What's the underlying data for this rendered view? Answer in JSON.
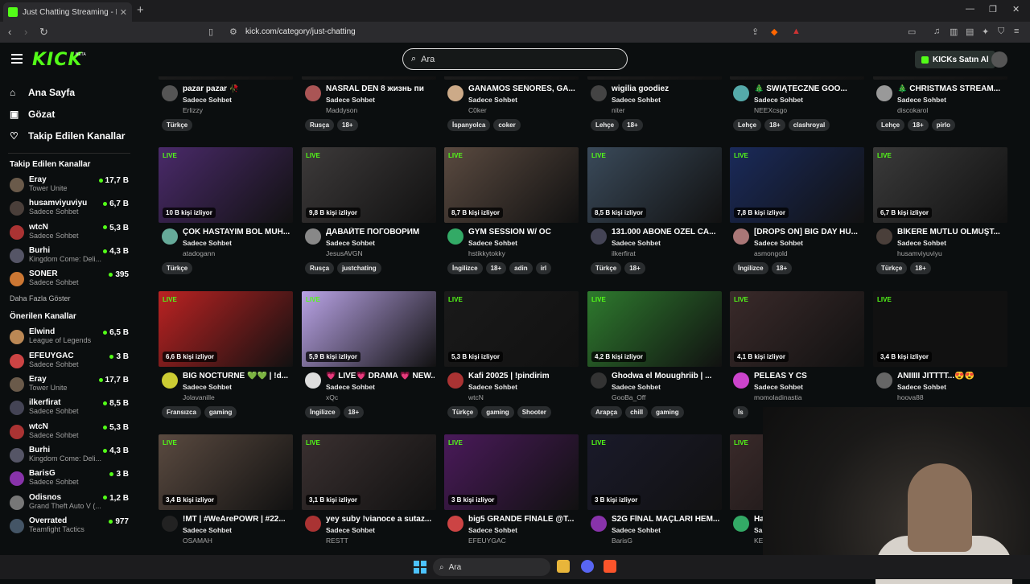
{
  "browser": {
    "tab_title": "Just Chatting Streaming - Live St",
    "tab_close": "✕",
    "new_tab": "+",
    "url": "kick.com/category/just-chatting"
  },
  "header": {
    "logo": "KICK",
    "beta": "BETA",
    "search_placeholder": "Ara",
    "kicks_button": "KICKs Satın Al"
  },
  "sidebar": {
    "nav": [
      {
        "label": "Ana Sayfa",
        "icon": "home-icon"
      },
      {
        "label": "Gözat",
        "icon": "browse-icon"
      },
      {
        "label": "Takip Edilen Kanallar",
        "icon": "heart-icon"
      }
    ],
    "followed_title": "Takip Edilen Kanallar",
    "followed": [
      {
        "name": "Eray",
        "category": "Tower Unite",
        "viewers": "17,7 B",
        "color": "#6a5a4a"
      },
      {
        "name": "husamviyuviyu",
        "category": "Sadece Sohbet",
        "viewers": "6,7 B",
        "color": "#4a3f3a"
      },
      {
        "name": "wtcN",
        "category": "Sadece Sohbet",
        "viewers": "5,3 B",
        "color": "#a33"
      },
      {
        "name": "Burhi",
        "category": "Kingdom Come: Deli...",
        "viewers": "4,3 B",
        "color": "#556"
      },
      {
        "name": "SONER",
        "category": "Sadece Sohbet",
        "viewers": "395",
        "color": "#c73"
      }
    ],
    "show_more": "Daha Fazla Göster",
    "recommended_title": "Önerilen Kanallar",
    "recommended": [
      {
        "name": "Elwind",
        "category": "League of Legends",
        "viewers": "6,5 B",
        "color": "#b85"
      },
      {
        "name": "EFEUYGAC",
        "category": "Sadece Sohbet",
        "viewers": "3 B",
        "color": "#c44"
      },
      {
        "name": "Eray",
        "category": "Tower Unite",
        "viewers": "17,7 B",
        "color": "#6a5a4a"
      },
      {
        "name": "ilkerfirat",
        "category": "Sadece Sohbet",
        "viewers": "8,5 B",
        "color": "#445"
      },
      {
        "name": "wtcN",
        "category": "Sadece Sohbet",
        "viewers": "5,3 B",
        "color": "#a33"
      },
      {
        "name": "Burhi",
        "category": "Kingdom Come: Deli...",
        "viewers": "4,3 B",
        "color": "#556"
      },
      {
        "name": "BarisG",
        "category": "Sadece Sohbet",
        "viewers": "3 B",
        "color": "#83a"
      },
      {
        "name": "Odisnos",
        "category": "Grand Theft Auto V (...",
        "viewers": "1,2 B",
        "color": "#777"
      },
      {
        "name": "Overrated",
        "category": "Teamfight Tactics",
        "viewers": "977",
        "color": "#456"
      }
    ]
  },
  "rows": [
    {
      "cards": [
        {
          "title": "pazar pazar 🥀",
          "category": "Sadece Sohbet",
          "streamer": "Erlizzy",
          "tags": [
            "Türkçe"
          ],
          "viewers": "",
          "color": "#222",
          "av": "#555"
        },
        {
          "title": "NASRAL DEN 8 жизнь пи",
          "category": "Sadece Sohbet",
          "streamer": "Maddyson",
          "tags": [
            "Rusça",
            "18+"
          ],
          "viewers": "",
          "color": "#222",
          "av": "#a55"
        },
        {
          "title": "GANAMOS SEÑORES, GA...",
          "category": "Sadece Sohbet",
          "streamer": "C0ker",
          "tags": [
            "İspanyolca",
            "coker"
          ],
          "viewers": "",
          "color": "#222",
          "av": "#ca8"
        },
        {
          "title": "wigilia goodiez",
          "category": "Sadece Sohbet",
          "streamer": "niter",
          "tags": [
            "Lehçe",
            "18+"
          ],
          "viewers": "",
          "color": "#222",
          "av": "#444"
        },
        {
          "title": "🎄 ŚWIĄTECZNE GOO...",
          "category": "Sadece Sohbet",
          "streamer": "NEEXcsgo",
          "tags": [
            "Lehçe",
            "18+",
            "clashroyal"
          ],
          "viewers": "",
          "color": "#222",
          "av": "#5aa"
        },
        {
          "title": "🎄 CHRISTMAS STREAM...",
          "category": "Sadece Sohbet",
          "streamer": "discokarol",
          "tags": [
            "Lehçe",
            "18+",
            "pirlo"
          ],
          "viewers": "",
          "color": "#222",
          "av": "#999"
        }
      ]
    },
    {
      "cards": [
        {
          "title": "ÇOK HASTAYIM BOL MUH...",
          "category": "Sadece Sohbet",
          "streamer": "atadogann",
          "tags": [
            "Türkçe"
          ],
          "viewers": "10 B kişi izliyor",
          "color": "#4a2a6a",
          "av": "#6a9"
        },
        {
          "title": "ДАВАЙТЕ ПОГОВОРИМ",
          "category": "Sadece Sohbet",
          "streamer": "JesusAVGN",
          "tags": [
            "Rusça",
            "justchating"
          ],
          "viewers": "9,8 B kişi izliyor",
          "color": "#3d3a3a",
          "av": "#888"
        },
        {
          "title": "GYM SESSION W/ OC",
          "category": "Sadece Sohbet",
          "streamer": "hstikkytokky",
          "tags": [
            "İngilizce",
            "18+",
            "adin",
            "irl"
          ],
          "viewers": "8,7 B kişi izliyor",
          "color": "#5a4a40",
          "av": "#3a6"
        },
        {
          "title": "131.000 ABONE ÖZEL CA...",
          "category": "Sadece Sohbet",
          "streamer": "ilkerfirat",
          "tags": [
            "Türkçe",
            "18+"
          ],
          "viewers": "8,5 B kişi izliyor",
          "color": "#3a4a5a",
          "av": "#445"
        },
        {
          "title": "[DROPS ON] BIG DAY HU...",
          "category": "Sadece Sohbet",
          "streamer": "asmongold",
          "tags": [
            "İngilizce",
            "18+"
          ],
          "viewers": "7,8 B kişi izliyor",
          "color": "#1a2a5a",
          "av": "#a77"
        },
        {
          "title": "BİKERE MUTLU OLMUŞT...",
          "category": "Sadece Sohbet",
          "streamer": "husamviyuviyu",
          "tags": [
            "Türkçe",
            "18+"
          ],
          "viewers": "6,7 B kişi izliyor",
          "color": "#3a3a3a",
          "av": "#4a3f3a"
        }
      ]
    },
    {
      "cards": [
        {
          "title": "BIG NOCTURNE 💚💚 | !d...",
          "category": "Sadece Sohbet",
          "streamer": "Jolavanille",
          "tags": [
            "Fransızca",
            "gaming"
          ],
          "viewers": "6,6 B kişi izliyor",
          "color": "#b22",
          "av": "#cc3"
        },
        {
          "title": "💗 LIVE💗 DRAMA 💗 NEW...",
          "category": "Sadece Sohbet",
          "streamer": "xQc",
          "tags": [
            "İngilizce",
            "18+"
          ],
          "viewers": "5,9 B kişi izliyor",
          "color": "#b9a3e6",
          "av": "#ddd"
        },
        {
          "title": "Kafi 20025 | !pindirim",
          "category": "Sadece Sohbet",
          "streamer": "wtcN",
          "tags": [
            "Türkçe",
            "gaming",
            "Shooter"
          ],
          "viewers": "5,3 B kişi izliyor",
          "color": "#1a1a1a",
          "av": "#a33"
        },
        {
          "title": "Ghodwa el Mouughriib | ...",
          "category": "Sadece Sohbet",
          "streamer": "GooBa_Off",
          "tags": [
            "Arapça",
            "chill",
            "gaming"
          ],
          "viewers": "4,2 B kişi izliyor",
          "color": "#2e7a2e",
          "av": "#333"
        },
        {
          "title": "PELEAS Y CS",
          "category": "Sadece Sohbet",
          "streamer": "momoladinastia",
          "tags": [
            "İs"
          ],
          "viewers": "4,1 B kişi izliyor",
          "color": "#3a2a2a",
          "av": "#c4c"
        },
        {
          "title": "ANIIIII JITTTT...😍😍",
          "category": "Sadece Sohbet",
          "streamer": "hoova88",
          "tags": [],
          "viewers": "3,4 B kişi izliyor",
          "color": "#111",
          "av": "#666"
        }
      ]
    },
    {
      "cards": [
        {
          "title": "!MT | #WeArePOWR | #22...",
          "category": "Sadece Sohbet",
          "streamer": "OSAMAH",
          "tags": [],
          "viewers": "3,4 B kişi izliyor",
          "color": "#5a4a40",
          "av": "#222"
        },
        {
          "title": "yey suby !vianoce a sutaz...",
          "category": "Sadece Sohbet",
          "streamer": "RESTT",
          "tags": [],
          "viewers": "3,1 B kişi izliyor",
          "color": "#3a3030",
          "av": "#a33"
        },
        {
          "title": "big5 GRANDE FİNALE @T...",
          "category": "Sadece Sohbet",
          "streamer": "EFEUYGAC",
          "tags": [],
          "viewers": "3 B kişi izliyor",
          "color": "#4a1a5a",
          "av": "#c44"
        },
        {
          "title": "S2G FİNAL MAÇLARI HEM...",
          "category": "Sadece Sohbet",
          "streamer": "BarisG",
          "tags": [],
          "viewers": "3 B kişi izliyor",
          "color": "#1a1a2a",
          "av": "#83a"
        },
        {
          "title": "Ha",
          "category": "Sa",
          "streamer": "KE",
          "tags": [],
          "viewers": "",
          "color": "#3a2a2a",
          "av": "#3a6"
        }
      ]
    }
  ],
  "live_label": "LIVE",
  "taskbar": {
    "search": "Ara"
  }
}
